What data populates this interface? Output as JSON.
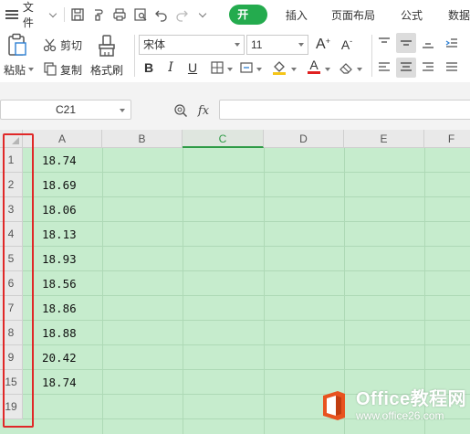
{
  "menubar": {
    "file_label": "文件",
    "tabs": [
      {
        "label": "开始",
        "active": true
      },
      {
        "label": "插入",
        "active": false
      },
      {
        "label": "页面布局",
        "active": false
      },
      {
        "label": "公式",
        "active": false
      },
      {
        "label": "数据",
        "active": false
      }
    ],
    "quick_access_icons": [
      "save-icon",
      "format-painter-icon",
      "print-icon",
      "print-preview-icon",
      "undo-icon",
      "redo-icon",
      "customize-dropdown-icon"
    ]
  },
  "ribbon": {
    "paste_label": "粘贴",
    "cut_label": "剪切",
    "copy_label": "复制",
    "format_painter_label": "格式刷",
    "font_name": "宋体",
    "font_size": "11",
    "bold": "B",
    "italic": "I",
    "underline": "U",
    "increase_font": "A",
    "decrease_font": "A",
    "font_color_letter": "A",
    "font_color": "#e02020",
    "fill_color": "#f5c518"
  },
  "formula_bar": {
    "name_box": "C21",
    "fx_label": "fx",
    "formula_value": ""
  },
  "grid": {
    "active_column": "C",
    "columns": [
      "A",
      "B",
      "C",
      "D",
      "E",
      "F"
    ],
    "rows": [
      {
        "label": "1",
        "value": "18.74"
      },
      {
        "label": "2",
        "value": "18.69"
      },
      {
        "label": "3",
        "value": "18.06"
      },
      {
        "label": "4",
        "value": "18.13"
      },
      {
        "label": "5",
        "value": "18.93"
      },
      {
        "label": "6",
        "value": "18.56"
      },
      {
        "label": "7",
        "value": "18.86"
      },
      {
        "label": "8",
        "value": "18.88"
      },
      {
        "label": "9",
        "value": "20.42"
      },
      {
        "label": "15",
        "value": "18.74"
      },
      {
        "label": "19",
        "value": ""
      }
    ],
    "highlight_color": "#e02828",
    "sheet_fill_color": "#c6eccd"
  },
  "watermark": {
    "title": "Office教程网",
    "url": "www.office26.com",
    "logo_color": "#e8531f"
  }
}
